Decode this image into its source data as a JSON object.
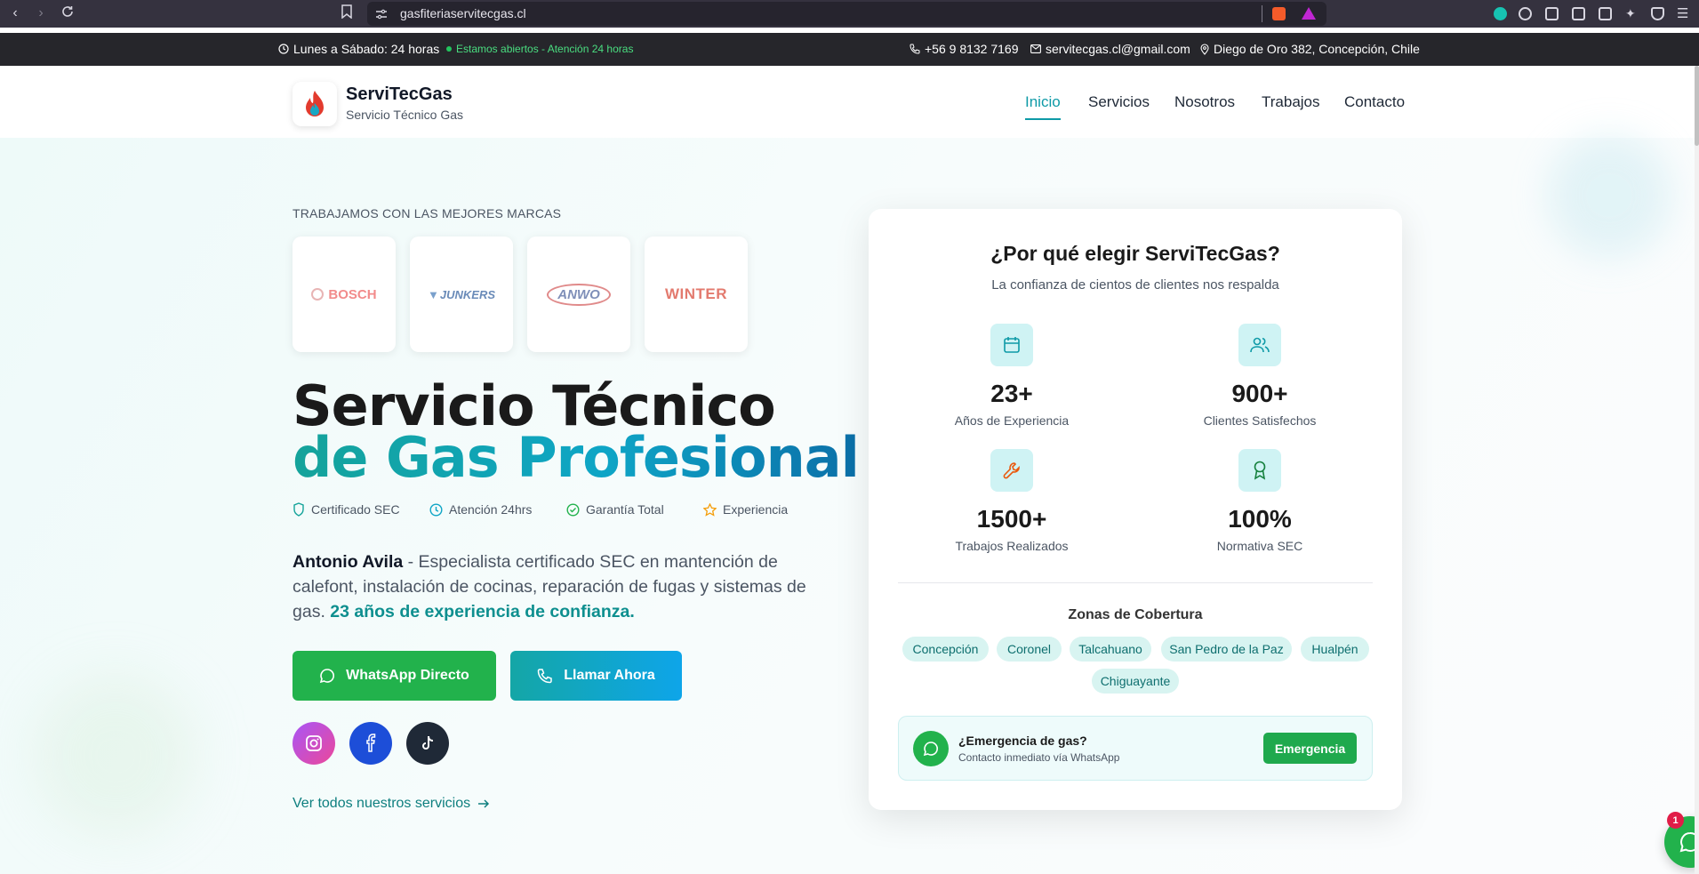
{
  "browser": {
    "url": "gasfiteriaservitecgas.cl",
    "back_icon": "chevron-left-icon",
    "forward_icon": "chevron-right-icon",
    "reload_icon": "reload-icon",
    "bookmark_icon": "bookmark-icon"
  },
  "topbar": {
    "hours": "Lunes a Sábado: 24 horas",
    "open_status": "Estamos abiertos - Atención 24 horas",
    "phone": "+56 9 8132 7169",
    "email": "servitecgas.cl@gmail.com",
    "address": "Diego de Oro 382, Concepción, Chile"
  },
  "header": {
    "brand_name": "ServiTecGas",
    "brand_sub": "Servicio Técnico Gas",
    "nav": [
      "Inicio",
      "Servicios",
      "Nosotros",
      "Trabajos",
      "Contacto"
    ]
  },
  "hero": {
    "brands_title": "TRABAJAMOS CON LAS MEJORES MARCAS",
    "brands": [
      "BOSCH",
      "JUNKERS",
      "ANWO",
      "WINTER"
    ],
    "title_line1": "Servicio Técnico",
    "title_line2": "de Gas Profesional",
    "features": [
      "Certificado SEC",
      "Atención 24hrs",
      "Garantía Total",
      "Experiencia"
    ],
    "desc_name": "Antonio Avila",
    "desc_body": " - Especialista certificado SEC en mantención de calefont, instalación de cocinas, reparación de fugas y sistemas de gas. ",
    "desc_highlight": "23 años de experiencia de confianza.",
    "btn_whatsapp": "WhatsApp Directo",
    "btn_call": "Llamar Ahora",
    "services_link": "Ver todos nuestros servicios"
  },
  "card": {
    "title": "¿Por qué elegir ServiTecGas?",
    "subtitle": "La confianza de cientos de clientes nos respalda",
    "stats": [
      {
        "value": "23+",
        "label": "Años de Experiencia"
      },
      {
        "value": "900+",
        "label": "Clientes Satisfechos"
      },
      {
        "value": "1500+",
        "label": "Trabajos Realizados"
      },
      {
        "value": "100%",
        "label": "Normativa SEC"
      }
    ],
    "zones_title": "Zonas de Cobertura",
    "zones": [
      "Concepción",
      "Coronel",
      "Talcahuano",
      "San Pedro de la Paz",
      "Hualpén",
      "Chiguayante"
    ],
    "emergency_title": "¿Emergencia de gas?",
    "emergency_sub": "Contacto inmediato vía WhatsApp",
    "emergency_btn": "Emergencia"
  },
  "fab": {
    "badge": "1"
  },
  "colors": {
    "accent": "#0e9aa7",
    "whatsapp": "#22b24c",
    "topbar": "#26262b"
  }
}
